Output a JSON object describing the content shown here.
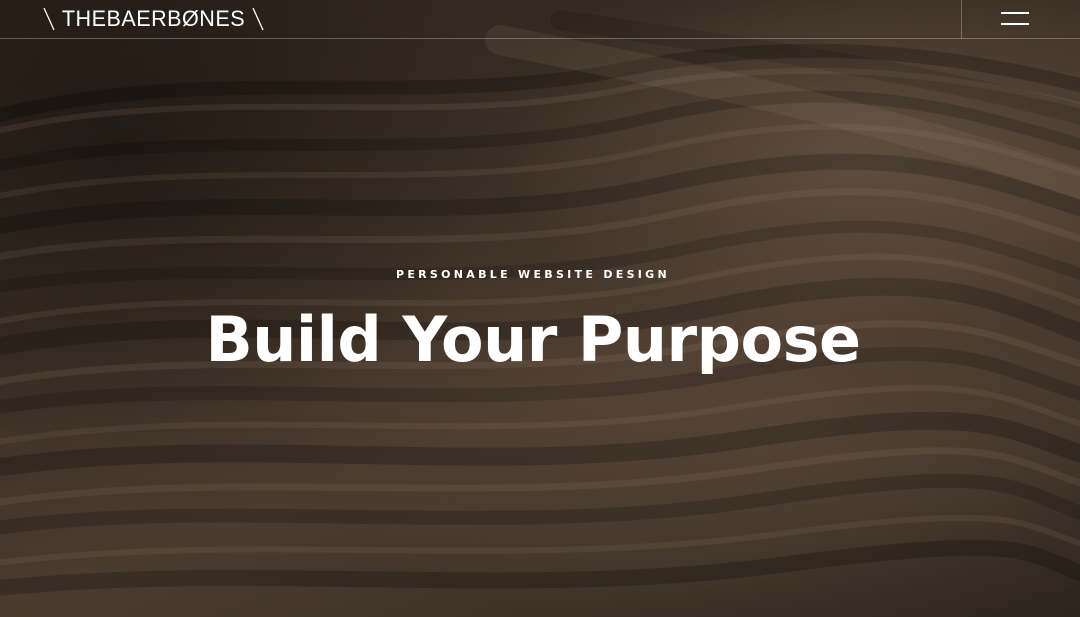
{
  "header": {
    "logo_text": "THEBAERBØNES",
    "menu_icon": "hamburger-menu-icon"
  },
  "hero": {
    "eyebrow": "PERSONABLE WEBSITE DESIGN",
    "headline": "Build Your Purpose",
    "background": "sand-dunes-image"
  },
  "colors": {
    "text": "#ffffff",
    "overlay": "#2a221c",
    "divider": "rgba(255,255,255,0.28)"
  }
}
